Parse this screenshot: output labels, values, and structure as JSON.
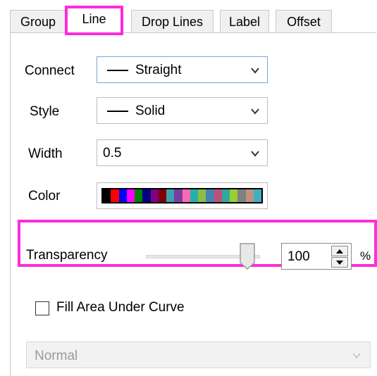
{
  "tabs": [
    {
      "label": "Group",
      "active": false
    },
    {
      "label": "Line",
      "active": true
    },
    {
      "label": "Drop Lines",
      "active": false
    },
    {
      "label": "Label",
      "active": false
    },
    {
      "label": "Offset",
      "active": false
    }
  ],
  "fields": {
    "connect": {
      "label": "Connect",
      "value": "Straight",
      "icon": "line-style-icon"
    },
    "style": {
      "label": "Style",
      "value": "Solid",
      "icon": "line-style-icon"
    },
    "width": {
      "label": "Width",
      "value": "0.5"
    },
    "color": {
      "label": "Color",
      "swatch_colors": [
        "#000000",
        "#ff0000",
        "#0000ff",
        "#ff00ff",
        "#008000",
        "#000080",
        "#800080",
        "#800000",
        "#3fa0b0",
        "#7a3ca0",
        "#ff69b4",
        "#20b2aa",
        "#8fbc3f",
        "#4682b4",
        "#c0507a",
        "#2ea8a0",
        "#9acd32",
        "#808080",
        "#c09080",
        "#40b0c0"
      ]
    }
  },
  "transparency": {
    "label": "Transparency",
    "value": "100",
    "unit": "%",
    "slider_fraction": 1.0
  },
  "fill_area": {
    "label": "Fill Area Under Curve",
    "checked": false
  },
  "fill_mode": {
    "value": "Normal",
    "disabled": true
  },
  "colors": {
    "highlight": "#ff2bdc"
  }
}
